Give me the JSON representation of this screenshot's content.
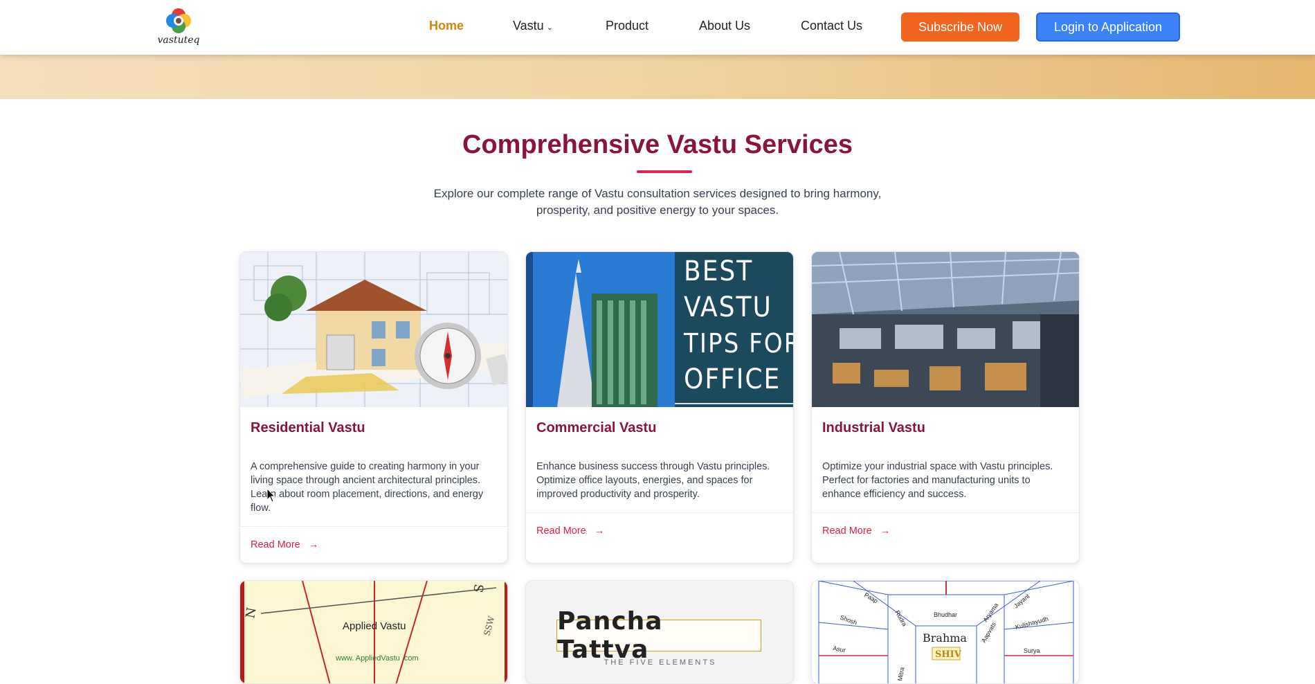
{
  "brand": {
    "logo_text": "vastuteq"
  },
  "nav": {
    "home": "Home",
    "vastu": "Vastu",
    "product": "Product",
    "about": "About Us",
    "contact": "Contact Us",
    "subscribe": "Subscribe Now",
    "login": "Login to Application"
  },
  "colors": {
    "accent_maroon": "#8b1538",
    "link_red": "#e11d48",
    "nav_active": "#d4860b",
    "subscribe_orange": "#f2651e",
    "login_blue": "#3b82f6"
  },
  "section": {
    "title": "Comprehensive Vastu Services",
    "subtitle": "Explore our complete range of Vastu consultation services designed to bring harmony, prosperity, and positive energy to your spaces."
  },
  "cards": [
    {
      "title": "Residential Vastu",
      "description": "A comprehensive guide to creating harmony in your living space through ancient architectural principles. Learn about room placement, directions, and energy flow.",
      "link": "Read More"
    },
    {
      "title": "Commercial Vastu",
      "description": "Enhance business success through Vastu principles. Optimize office layouts, energies, and spaces for improved productivity and prosperity.",
      "link": "Read More",
      "image_text": [
        "BEST",
        "VASTU",
        "TIPS FOR",
        "OFFICE"
      ]
    },
    {
      "title": "Industrial Vastu",
      "description": "Optimize your industrial space with Vastu principles. Perfect for factories and manufacturing units to enhance efficiency and success.",
      "link": "Read More"
    }
  ],
  "row2_cards": [
    {
      "image_text": "Applied Vastu",
      "url_text": "www. AppliedVastu .com",
      "compass": [
        "N",
        "S",
        "SSW"
      ]
    },
    {
      "image_text": "Pancha Tattva",
      "sub_text": "THE FIVE ELEMENTS"
    },
    {
      "image_text": "Brahma",
      "sub_text": "SHIV",
      "labels": [
        "Bhudhar",
        "Aryama",
        "Jayant",
        "Kulishayudh",
        "Surya",
        "Paap",
        "Rudra",
        "Shosh",
        "Asur",
        "Aapvats",
        "Aapvatsa",
        "Mitra"
      ]
    }
  ]
}
